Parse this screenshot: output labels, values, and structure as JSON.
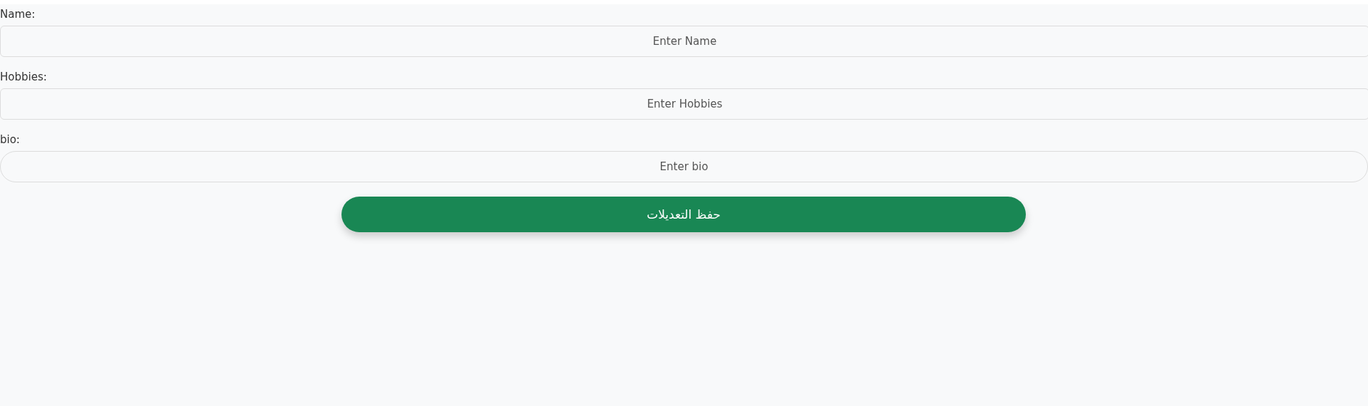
{
  "fields": [
    {
      "label": "Name:",
      "placeholder": "Enter Name",
      "kind": "text"
    },
    {
      "label": "Hobbies:",
      "placeholder": "Enter Hobbies",
      "kind": "text"
    },
    {
      "label": "bio:",
      "placeholder": "Enter bio",
      "kind": "pill"
    }
  ],
  "save_button": {
    "label": "حفظ التعديلات"
  }
}
